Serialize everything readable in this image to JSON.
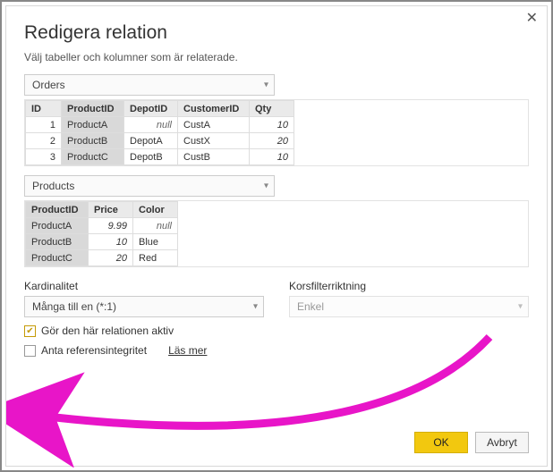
{
  "dialog": {
    "title": "Redigera relation",
    "subtitle": "Välj tabeller och kolumner som är relaterade.",
    "close": "✕"
  },
  "table1": {
    "name": "Orders",
    "headers": [
      "ID",
      "ProductID",
      "DepotID",
      "CustomerID",
      "Qty"
    ],
    "rows": [
      [
        "1",
        "ProductA",
        "null",
        "CustA",
        "10"
      ],
      [
        "2",
        "ProductB",
        "DepotA",
        "CustX",
        "20"
      ],
      [
        "3",
        "ProductC",
        "DepotB",
        "CustB",
        "10"
      ]
    ],
    "selectedCol": 1
  },
  "table2": {
    "name": "Products",
    "headers": [
      "ProductID",
      "Price",
      "Color"
    ],
    "rows": [
      [
        "ProductA",
        "9.99",
        "null"
      ],
      [
        "ProductB",
        "10",
        "Blue"
      ],
      [
        "ProductC",
        "20",
        "Red"
      ]
    ],
    "selectedCol": 0
  },
  "cardinality": {
    "label": "Kardinalitet",
    "value": "Många till en (*:1)"
  },
  "crossfilter": {
    "label": "Korsfilterriktning",
    "value": "Enkel"
  },
  "checkActive": {
    "label": "Gör den här relationen aktiv",
    "checked": true
  },
  "checkRef": {
    "label": "Anta referensintegritet",
    "checked": false
  },
  "learnMore": "Läs mer",
  "buttons": {
    "ok": "OK",
    "cancel": "Avbryt"
  },
  "chevron": "▾",
  "checkmark": "✔"
}
